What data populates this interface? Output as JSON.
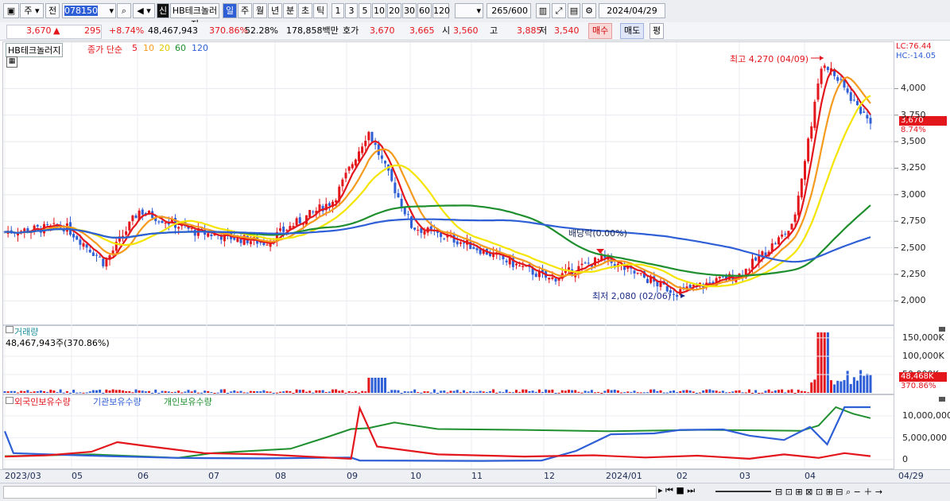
{
  "toolbar": {
    "code": "078150",
    "stock_name": "HB테크놀러지",
    "mode_ju": "주",
    "mode_jeon": "전",
    "sin_label": "신",
    "periods": [
      "일",
      "주",
      "월",
      "년",
      "분",
      "초",
      "틱"
    ],
    "nums": [
      "1",
      "3",
      "5",
      "10",
      "20",
      "30",
      "60",
      "120"
    ],
    "count": "265",
    "count_total": "/600",
    "date": "2024/04/29"
  },
  "quote": {
    "price": "3,670",
    "arrow": "▲",
    "change": "295",
    "change_pct": "+8.74%",
    "volume": "48,467,943",
    "vol_pct": "370.86%",
    "turnover": "52.28%",
    "amount": "178,858백만",
    "hoga_label": "호가",
    "hoga1": "3,670",
    "hoga2": "3,665",
    "open_label": "시",
    "open": "3,560",
    "high_label": "고",
    "high": "3,885",
    "low_label": "저",
    "low": "3,540",
    "buy": "매수",
    "sell": "매도",
    "avg": "평"
  },
  "price_panel": {
    "name_label": "HB테크놀러지",
    "ma_label": "종가 단순",
    "ma_periods": [
      "5",
      "10",
      "20",
      "60",
      "120"
    ],
    "ma_colors": [
      "#e3161c",
      "#f59a1c",
      "#f4e400",
      "#1f8f2e",
      "#2f5fd6"
    ],
    "lc": "LC:76.44",
    "hc": "HC:-14.05",
    "high_note": "최고 4,270 (04/09)",
    "low_note": "최저 2,080 (02/06)",
    "dividend_note": "배당락(0.00%)",
    "current_tag": "3,670",
    "current_pct": "8.74%",
    "y_ticks": [
      "4,000",
      "3,750",
      "3,500",
      "3,250",
      "3,000",
      "2,750",
      "2,500",
      "2,250",
      "2,000"
    ]
  },
  "volume_panel": {
    "title": "거래량",
    "value": "48,467,943주(370.86%)",
    "y_ticks": [
      "150,000K",
      "100,000K",
      "50,000K"
    ],
    "tag": "48,468K",
    "tag_pct": "370.86%"
  },
  "holdings_panel": {
    "labels": [
      "외국인보유수량",
      "기관보유수량",
      "개인보유수량"
    ],
    "colors": [
      "#e3161c",
      "#2f5fd6",
      "#1f8f2e"
    ],
    "y_ticks": [
      "10,000,000",
      "5,000,000",
      "0"
    ]
  },
  "x_axis": [
    "2023/03",
    "05",
    "06",
    "07",
    "08",
    "09",
    "10",
    "11",
    "12",
    "2024/01",
    "02",
    "03",
    "04",
    "04/29"
  ],
  "chart_data": {
    "type": "candlestick",
    "ylim": [
      1800,
      4400
    ],
    "y_ticks": [
      2000,
      2250,
      2500,
      2750,
      3000,
      3250,
      3500,
      3750,
      4000
    ],
    "anchors": [
      {
        "date": "2023/03",
        "price": 2650
      },
      {
        "date": "04",
        "price": 2700
      },
      {
        "date": "05",
        "price": 2400
      },
      {
        "date": "05 late",
        "price": 2350
      },
      {
        "date": "06",
        "price": 2850
      },
      {
        "date": "07",
        "price": 2650
      },
      {
        "date": "08",
        "price": 2550
      },
      {
        "date": "09",
        "price": 2950
      },
      {
        "date": "09 peak",
        "price": 3600
      },
      {
        "date": "10",
        "price": 2700
      },
      {
        "date": "11",
        "price": 2550
      },
      {
        "date": "12",
        "price": 2200
      },
      {
        "date": "2024/01",
        "price": 2400
      },
      {
        "date": "02/06",
        "price": 2080
      },
      {
        "date": "03",
        "price": 2250
      },
      {
        "date": "04",
        "price": 2700
      },
      {
        "date": "04/09",
        "price": 4270
      },
      {
        "date": "04/29",
        "price": 3670
      }
    ],
    "volume_max_K": 165000,
    "volume_ticks_K": [
      50000,
      100000,
      150000
    ],
    "holdings_ylim": [
      0,
      12000000
    ],
    "holdings_ticks": [
      0,
      5000000,
      10000000
    ]
  }
}
